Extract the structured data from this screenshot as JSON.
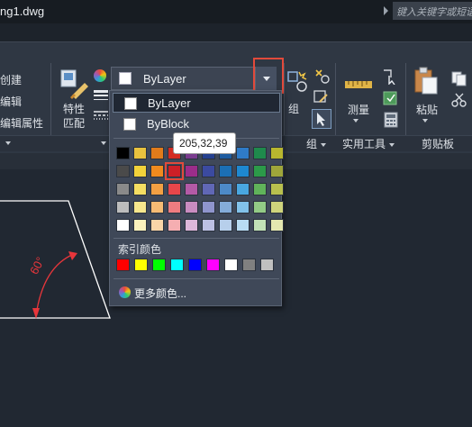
{
  "window": {
    "title": "ng1.dwg"
  },
  "search": {
    "placeholder": "键入关键字或短语"
  },
  "ribbon": {
    "left_items": [
      "创建",
      "编辑",
      "编辑属性"
    ],
    "properties": {
      "label_line1": "特性",
      "label_line2": "匹配"
    },
    "groups": {
      "group_label": "组",
      "group_footer": "组"
    },
    "utilities": {
      "measure": "测量",
      "footer": "实用工具"
    },
    "clipboard": {
      "paste": "粘贴",
      "footer": "剪贴板"
    }
  },
  "layer_combo": {
    "value": "ByLayer"
  },
  "color_dropdown": {
    "items": [
      "ByLayer",
      "ByBlock"
    ],
    "tooltip": "205,32,39",
    "index_colors_label": "索引颜色",
    "more_colors_label": "更多颜色...",
    "colors": {
      "row1": [
        "#000000",
        "#e9c23e",
        "#e07b1b",
        "#d42b22",
        "#7a3c8f",
        "#25408f",
        "#1e5ca0",
        "#2f7bc7",
        "#1f8a4c",
        "#b9b72e"
      ],
      "row2": [
        "#4a4a4a",
        "#f2d23a",
        "#f08a1e",
        "#cd2027",
        "#9b2d8a",
        "#3b4aa0",
        "#1b6fb5",
        "#1e88d0",
        "#2c9a49",
        "#9fa63a"
      ],
      "row3": [
        "#8a8a8a",
        "#f5de62",
        "#f3a043",
        "#e8464a",
        "#b45aa6",
        "#6067b5",
        "#4d8ac8",
        "#49a7e0",
        "#60b35a",
        "#b9c04e"
      ],
      "row4": [
        "#bdbdbd",
        "#f7e78d",
        "#f6bb74",
        "#ee7c80",
        "#c98cc0",
        "#8f95cd",
        "#84acd9",
        "#82c2ea",
        "#93cb86",
        "#cfd47c"
      ],
      "row5": [
        "#ffffff",
        "#fbf2bd",
        "#fad5a8",
        "#f5aeb1",
        "#ddb7da",
        "#bcc0e3",
        "#b7cfeb",
        "#b8dcf3",
        "#c2e2b7",
        "#e4e7b0"
      ],
      "index": [
        "#ff0000",
        "#ffff00",
        "#00ff00",
        "#00ffff",
        "#0000ff",
        "#ff00ff",
        "#ffffff",
        "#808080",
        "#c0c0c0"
      ]
    }
  },
  "drawing": {
    "angle_label": "60°"
  }
}
